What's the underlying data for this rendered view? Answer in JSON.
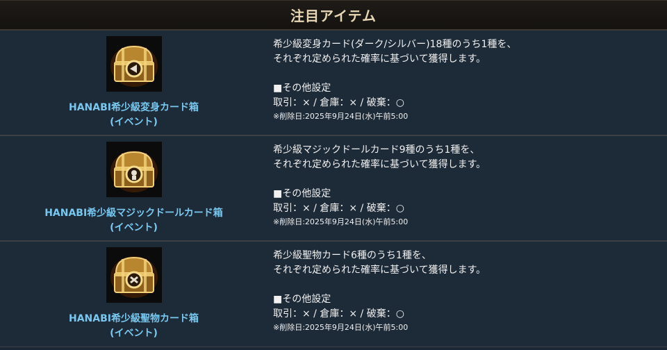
{
  "header": {
    "title": "注目アイテム"
  },
  "items": [
    {
      "icon": "treasure-chest-icon",
      "name_line1": "HANABI希少級変身カード箱",
      "name_line2": "(イベント)",
      "desc_line1": "希少級変身カード(ダーク/シルバー)18種のうち1種を、",
      "desc_line2": "それぞれ定められた確率に基づいて獲得します。",
      "settings_label": "■その他設定",
      "settings_values": "取引：× / 倉庫：× / 破棄：○",
      "deletion": "※削除日:2025年9月24日(水)午前5:00"
    },
    {
      "icon": "treasure-chest-icon",
      "name_line1": "HANABI希少級マジックドールカード箱",
      "name_line2": "(イベント)",
      "desc_line1": "希少級マジックドールカード9種のうち1種を、",
      "desc_line2": "それぞれ定められた確率に基づいて獲得します。",
      "settings_label": "■その他設定",
      "settings_values": "取引：× / 倉庫：× / 破棄：○",
      "deletion": "※削除日:2025年9月24日(水)午前5:00"
    },
    {
      "icon": "treasure-chest-icon",
      "name_line1": "HANABI希少級聖物カード箱",
      "name_line2": "(イベント)",
      "desc_line1": "希少級聖物カード6種のうち1種を、",
      "desc_line2": "それぞれ定められた確率に基づいて獲得します。",
      "settings_label": "■その他設定",
      "settings_values": "取引：× / 倉庫：× / 破棄：○",
      "deletion": "※削除日:2025年9月24日(水)午前5:00"
    }
  ]
}
